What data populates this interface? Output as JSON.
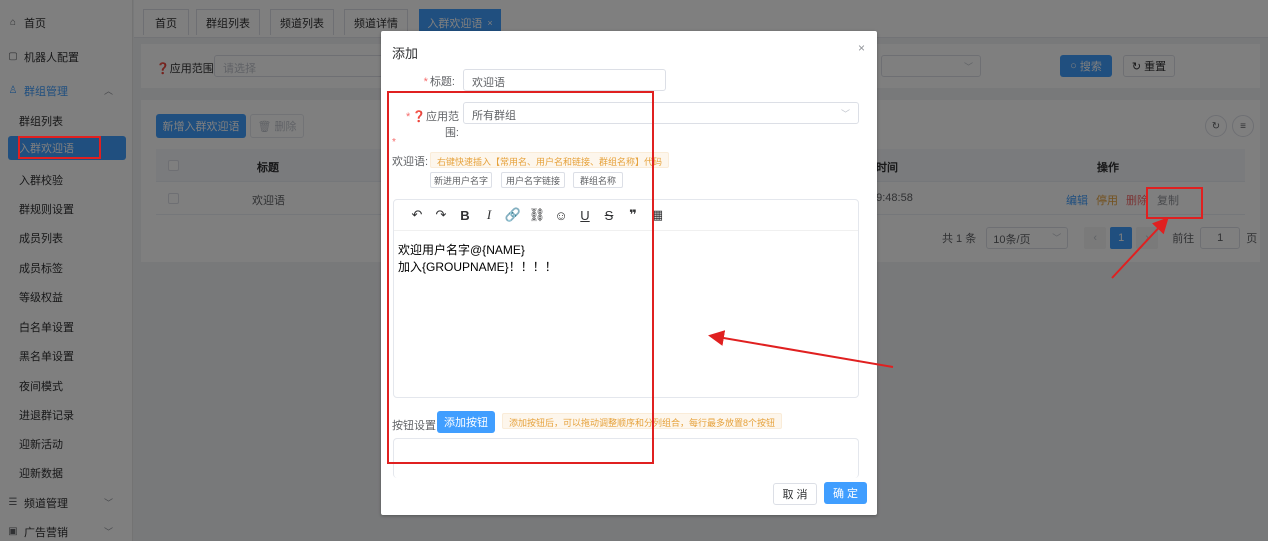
{
  "sidebar": {
    "items": [
      {
        "label": "首页",
        "icon": "home-icon"
      },
      {
        "label": "机器人配置",
        "icon": "robot-icon"
      },
      {
        "label": "群组管理",
        "icon": "group-icon"
      },
      {
        "label": "群组列表"
      },
      {
        "label": "入群欢迎语"
      },
      {
        "label": "入群校验"
      },
      {
        "label": "群规则设置"
      },
      {
        "label": "成员列表"
      },
      {
        "label": "成员标签"
      },
      {
        "label": "等级权益"
      },
      {
        "label": "白名单设置"
      },
      {
        "label": "黑名单设置"
      },
      {
        "label": "夜间模式"
      },
      {
        "label": "进退群记录"
      },
      {
        "label": "迎新活动"
      },
      {
        "label": "迎新数据"
      },
      {
        "label": "频道管理",
        "icon": "channel-icon"
      },
      {
        "label": "广告营销",
        "icon": "ad-icon"
      }
    ]
  },
  "tabs": [
    "首页",
    "群组列表",
    "频道列表",
    "频道详情",
    "入群欢迎语"
  ],
  "filter": {
    "scope_label": "❓应用范围",
    "scope_placeholder": "请选择",
    "search_label": "搜索",
    "reset_label": "重置"
  },
  "table": {
    "add_label": "新增入群欢迎语",
    "delete_label": "删除",
    "headers": {
      "title": "标题",
      "time": "时间",
      "actions": "操作"
    },
    "rows": [
      {
        "title": "欢迎语",
        "time": "09:48:58"
      }
    ],
    "actions": {
      "edit": "编辑",
      "disable": "停用",
      "delete": "删除",
      "copy": "复制"
    },
    "pager": {
      "total": "共 1 条",
      "page_size": "10条/页",
      "current_page": "1",
      "goto_label": "前往",
      "goto_value": "1",
      "page_unit": "页"
    }
  },
  "dialog": {
    "title": "添加",
    "title_label": "标题:",
    "title_value": "欢迎语",
    "scope_label": "❓应用范围:",
    "scope_value": "所有群组",
    "welcome_label": "欢迎语:",
    "welcome_hint": "右键快速插入【常用名、用户名和链接、群组名称】代码",
    "insert_buttons": [
      "新进用户名字",
      "用户名字链接",
      "群组名称"
    ],
    "editor_lines": [
      "欢迎用户名字@{NAME}",
      "加入{GROUPNAME}！！！！"
    ],
    "buttons_label": "按钮设置:",
    "add_button_label": "添加按钮",
    "buttons_hint": "添加按钮后，可以拖动调整顺序和分列组合，每行最多放置8个按钮",
    "cancel_label": "取 消",
    "confirm_label": "确 定"
  },
  "colors": {
    "primary": "#409eff",
    "danger": "#f56c6c",
    "warning": "#e6a23c",
    "annotation": "#e02020"
  }
}
